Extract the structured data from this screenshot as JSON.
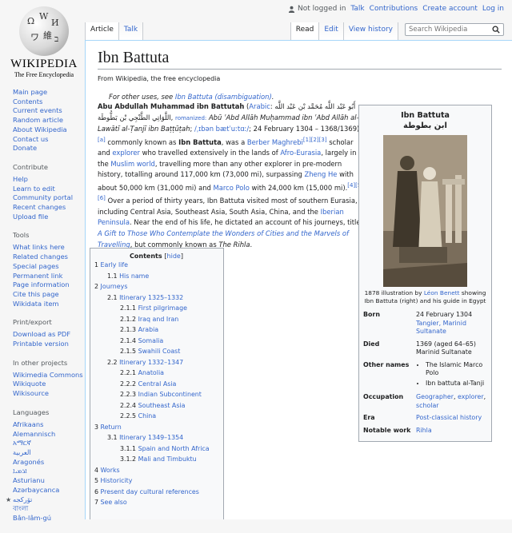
{
  "personal": {
    "not_logged_in": "Not logged in",
    "links": [
      "Talk",
      "Contributions",
      "Create account",
      "Log in"
    ]
  },
  "logo": {
    "wordmark": "WIKIPEDIA",
    "tagline": "The Free Encyclopedia"
  },
  "tabs": {
    "left": [
      {
        "label": "Article",
        "selected": true
      },
      {
        "label": "Talk",
        "selected": false
      }
    ],
    "right": [
      {
        "label": "Read",
        "selected": true
      },
      {
        "label": "Edit",
        "selected": false
      },
      {
        "label": "View history",
        "selected": false
      }
    ]
  },
  "search": {
    "placeholder": "Search Wikipedia"
  },
  "sidebar": {
    "main": [
      "Main page",
      "Contents",
      "Current events",
      "Random article",
      "About Wikipedia",
      "Contact us",
      "Donate"
    ],
    "contribute": {
      "heading": "Contribute",
      "items": [
        "Help",
        "Learn to edit",
        "Community portal",
        "Recent changes",
        "Upload file"
      ]
    },
    "tools": {
      "heading": "Tools",
      "items": [
        "What links here",
        "Related changes",
        "Special pages",
        "Permanent link",
        "Page information",
        "Cite this page",
        "Wikidata item"
      ]
    },
    "print": {
      "heading": "Print/export",
      "items": [
        "Download as PDF",
        "Printable version"
      ]
    },
    "projects": {
      "heading": "In other projects",
      "items": [
        "Wikimedia Commons",
        "Wikiquote",
        "Wikisource"
      ]
    },
    "languages": {
      "heading": "Languages",
      "items": [
        "Afrikaans",
        "Alemannisch",
        "አማርኛ",
        "العربية",
        "Aragonés",
        "ܐܪܡܝܐ",
        "Asturianu",
        "Azərbaycanca",
        "تۆرکجه",
        "বাংলা",
        "Bân-lâm-gú"
      ]
    }
  },
  "article": {
    "title": "Ibn Battuta",
    "tagline": "From Wikipedia, the free encyclopedia",
    "hatnote_prefix": "For other uses, see ",
    "hatnote_link": "Ibn Battuta (disambiguation)",
    "hatnote_suffix": ".",
    "lead": {
      "name_bold": "Abu Abdullah Muhammad ibn Battutah",
      "arabic_link": "Arabic",
      "arabic_text": "أَبُو عَبْد اللَّه مُحَمَّد بْن عَبْد اللَّه اللَّوَاتِي الطَّنْجِي بْن بَطُّوطَة",
      "romanized_label": "romanized:",
      "romanized_text": "Abū ʿAbd Allāh Muḥammad ibn ʿAbd Allāh al-Lawātī al-Ṭanjī ibn Baṭṭūṭah",
      "ipa": "/ˌɪbən bætˈuːtɑː/",
      "dates": "; 24 February 1304 – 1368/1369),",
      "ref_a": "[a]",
      "known_as": " commonly known as ",
      "known_bold": "Ibn Battuta",
      "was_a": ", was a ",
      "berber": "Berber",
      "maghrebi": "Maghrebi",
      "refs_1": "[1][2][3]",
      "scholar": " scholar and ",
      "explorer": "explorer",
      "travelled": " who travelled extensively in the lands of ",
      "afro": "Afro-Eurasia",
      "largely": ", largely in the ",
      "muslim_world": "Muslim world",
      "travelling": ", travelling more than any other explorer in pre-modern history, totalling around 117,000 km (73,000 mi), surpassing ",
      "zheng_he": "Zheng He",
      "with_about": " with about 50,000 km (31,000 mi) and ",
      "marco_polo": "Marco Polo",
      "with_24": " with 24,000 km (15,000 mi).",
      "refs_2": "[4][5][6]",
      "thirty": " Over a period of thirty years, Ibn Battuta visited most of southern Eurasia, including Central Asia, Southeast Asia, South Asia, China, and the ",
      "iberian": "Iberian Peninsula",
      "near_end": ". Near the end of his life, he dictated an account of his journeys, titled ",
      "gift": "A Gift to Those Who Contemplate the Wonders of Cities and the Marvels of Travelling",
      "commonly": ", but commonly known as ",
      "rihla": "The Rihla",
      "period": "."
    }
  },
  "infobox": {
    "title": "Ibn Battuta",
    "arabic_title": "ابن بطوطة",
    "caption_prefix": "1878 illustration by ",
    "caption_link": "Léon Benett",
    "caption_suffix": " showing Ibn Battuta (right) and his guide in Egypt",
    "rows": {
      "born_label": "Born",
      "born_date": "24 February 1304",
      "born_place": "Tangier, Marinid Sultanate",
      "died_label": "Died",
      "died_value": "1369 (aged 64–65)",
      "died_place": "Marinid Sultanate",
      "other_names_label": "Other names",
      "other_names": [
        "The Islamic Marco Polo",
        "Ibn battuta al-Tanji"
      ],
      "occupation_label": "Occupation",
      "occupation": [
        "Geographer",
        "explorer",
        "scholar"
      ],
      "era_label": "Era",
      "era": "Post-classical history",
      "notable_label": "Notable work",
      "notable": "Rihla"
    }
  },
  "toc": {
    "title": "Contents",
    "hide": "hide",
    "entries": [
      {
        "num": "1",
        "label": "Early life",
        "level": 1
      },
      {
        "num": "1.1",
        "label": "His name",
        "level": 2
      },
      {
        "num": "2",
        "label": "Journeys",
        "level": 1
      },
      {
        "num": "2.1",
        "label": "Itinerary 1325–1332",
        "level": 2
      },
      {
        "num": "2.1.1",
        "label": "First pilgrimage",
        "level": 3
      },
      {
        "num": "2.1.2",
        "label": "Iraq and Iran",
        "level": 3
      },
      {
        "num": "2.1.3",
        "label": "Arabia",
        "level": 3
      },
      {
        "num": "2.1.4",
        "label": "Somalia",
        "level": 3
      },
      {
        "num": "2.1.5",
        "label": "Swahili Coast",
        "level": 3
      },
      {
        "num": "2.2",
        "label": "Itinerary 1332–1347",
        "level": 2
      },
      {
        "num": "2.2.1",
        "label": "Anatolia",
        "level": 3
      },
      {
        "num": "2.2.2",
        "label": "Central Asia",
        "level": 3
      },
      {
        "num": "2.2.3",
        "label": "Indian Subcontinent",
        "level": 3
      },
      {
        "num": "2.2.4",
        "label": "Southeast Asia",
        "level": 3
      },
      {
        "num": "2.2.5",
        "label": "China",
        "level": 3
      },
      {
        "num": "3",
        "label": "Return",
        "level": 1
      },
      {
        "num": "3.1",
        "label": "Itinerary 1349–1354",
        "level": 2
      },
      {
        "num": "3.1.1",
        "label": "Spain and North Africa",
        "level": 3
      },
      {
        "num": "3.1.2",
        "label": "Mali and Timbuktu",
        "level": 3
      },
      {
        "num": "4",
        "label": "Works",
        "level": 1
      },
      {
        "num": "5",
        "label": "Historicity",
        "level": 1
      },
      {
        "num": "6",
        "label": "Present day cultural references",
        "level": 1
      },
      {
        "num": "7",
        "label": "See also",
        "level": 1
      }
    ]
  },
  "colors": {
    "link": "#3366cc",
    "text": "#202122",
    "border": "#a2a9b1",
    "muted": "#54595d"
  },
  "icons": [
    "user-icon",
    "search-icon",
    "wikipedia-globe-logo",
    "gear-icon"
  ]
}
